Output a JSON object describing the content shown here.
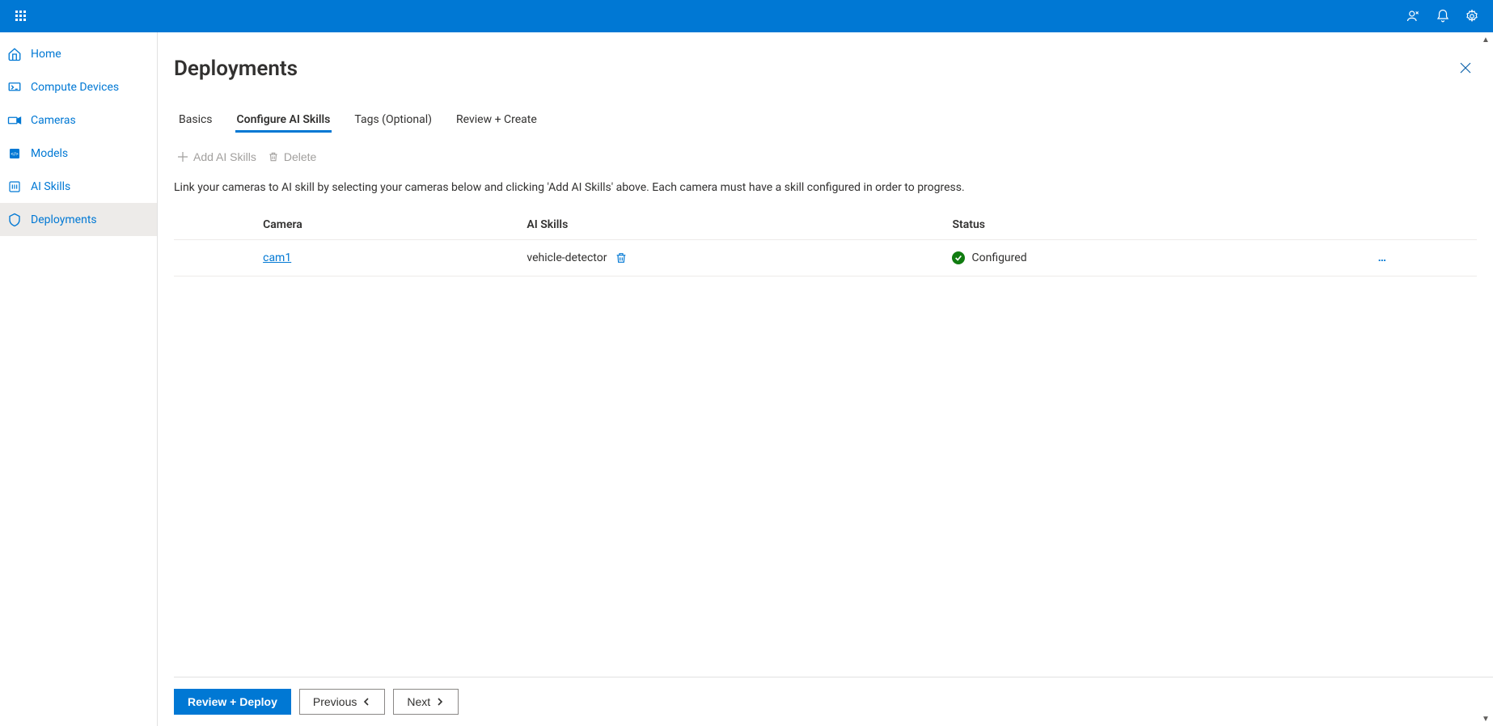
{
  "sidebar": {
    "items": [
      {
        "label": "Home"
      },
      {
        "label": "Compute Devices"
      },
      {
        "label": "Cameras"
      },
      {
        "label": "Models"
      },
      {
        "label": "AI Skills"
      },
      {
        "label": "Deployments"
      }
    ]
  },
  "page": {
    "title": "Deployments"
  },
  "tabs": [
    {
      "label": "Basics"
    },
    {
      "label": "Configure AI Skills"
    },
    {
      "label": "Tags (Optional)"
    },
    {
      "label": "Review + Create"
    }
  ],
  "toolbar": {
    "addLabel": "Add AI Skills",
    "deleteLabel": "Delete"
  },
  "helpText": "Link your cameras to AI skill by selecting your cameras below and clicking 'Add AI Skills' above. Each camera must have a skill configured in order to progress.",
  "table": {
    "headers": {
      "camera": "Camera",
      "aiSkills": "AI Skills",
      "status": "Status"
    },
    "rows": [
      {
        "camera": "cam1",
        "skill": "vehicle-detector",
        "status": "Configured"
      }
    ]
  },
  "footer": {
    "reviewDeploy": "Review + Deploy",
    "previous": "Previous",
    "next": "Next"
  }
}
